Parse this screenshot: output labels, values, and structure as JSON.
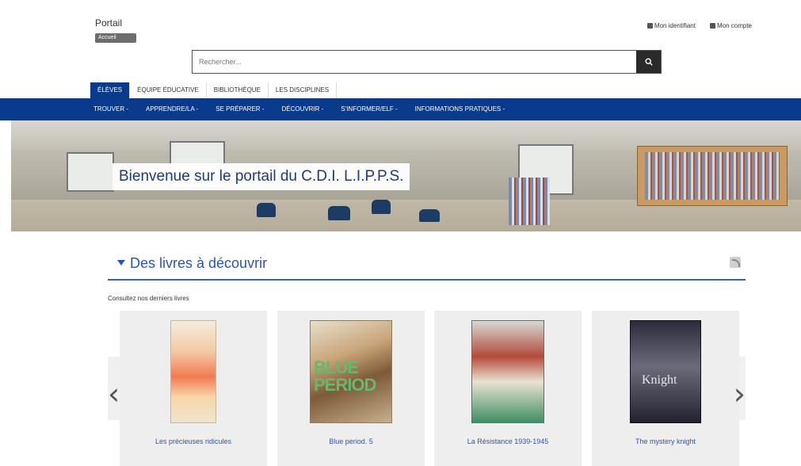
{
  "brand": {
    "title": "Portail",
    "badge": "Accueil"
  },
  "user_links": [
    "Mon identifiant",
    "Mon compte"
  ],
  "search": {
    "placeholder": "Rechercher..."
  },
  "audience_tabs": [
    "ÉLÈVES",
    "ÉQUIPE ÉDUCATIVE",
    "BIBLIOTHÈQUE",
    "LES DISCIPLINES"
  ],
  "nav_items": [
    "TROUVER -",
    "APPRENDRE/LA -",
    "SE PRÉPARER -",
    "DÉCOUVRIR -",
    "S'INFORMER/ELF -",
    "INFORMATIONS PRATIQUES -"
  ],
  "hero": {
    "caption": "Bienvenue sur le portail du C.D.I. L.I.P.P.S."
  },
  "section": {
    "title": "Des livres à découvrir",
    "subtitle": "Consultez nos derniers livres"
  },
  "books": [
    {
      "title": "Les précieuses ridicules"
    },
    {
      "title": "Blue period. 5",
      "cover_text": "BLUE PERIOD"
    },
    {
      "title": "La Résistance 1939-1945"
    },
    {
      "title": "The mystery knight",
      "cover_text": "Knight"
    }
  ],
  "colors": {
    "primary": "#0a3a8c",
    "accent": "#2b55b5"
  }
}
